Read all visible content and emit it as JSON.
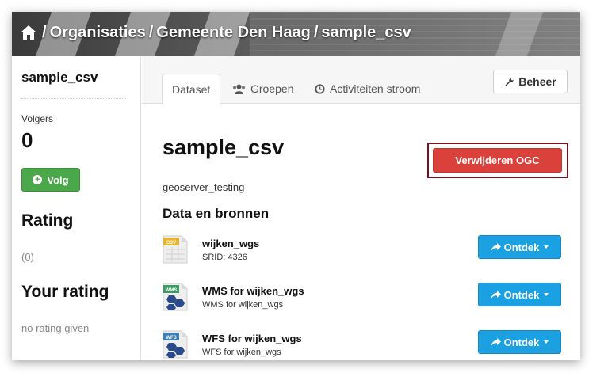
{
  "breadcrumb": {
    "items": [
      "Organisaties",
      "Gemeente Den Haag",
      "sample_csv"
    ],
    "separator": "/"
  },
  "sidebar": {
    "title": "sample_csv",
    "followers_label": "Volgers",
    "followers_count": "0",
    "follow_label": "Volg",
    "rating_heading": "Rating",
    "rating_count": "(0)",
    "your_rating_heading": "Your rating",
    "your_rating_value": "no rating given"
  },
  "tabs": [
    {
      "label": "Dataset",
      "icon": "none",
      "active": true
    },
    {
      "label": "Groepen",
      "icon": "users-icon",
      "active": false
    },
    {
      "label": "Activiteiten stroom",
      "icon": "clock-icon",
      "active": false
    }
  ],
  "manage_label": "Beheer",
  "dataset": {
    "title": "sample_csv",
    "delete_label": "Verwijderen OGC",
    "organization": "geoserver_testing",
    "resources_heading": "Data en bronnen"
  },
  "resources": [
    {
      "name": "wijken_wgs",
      "description": "SRID: 4326",
      "format": "CSV",
      "icon": "csv-file-icon",
      "explore_label": "Ontdek"
    },
    {
      "name": "WMS for wijken_wgs",
      "description": "WMS for wijken_wgs",
      "format": "WMS",
      "icon": "wms-file-icon",
      "explore_label": "Ontdek"
    },
    {
      "name": "WFS for wijken_wgs",
      "description": "WFS for wijken_wgs",
      "format": "WFS",
      "icon": "wfs-file-icon",
      "explore_label": "Ontdek"
    }
  ],
  "colors": {
    "follow": "#4aa84a",
    "delete": "#d9413a",
    "delete_frame": "#7a1020",
    "explore": "#1ba1e2"
  }
}
